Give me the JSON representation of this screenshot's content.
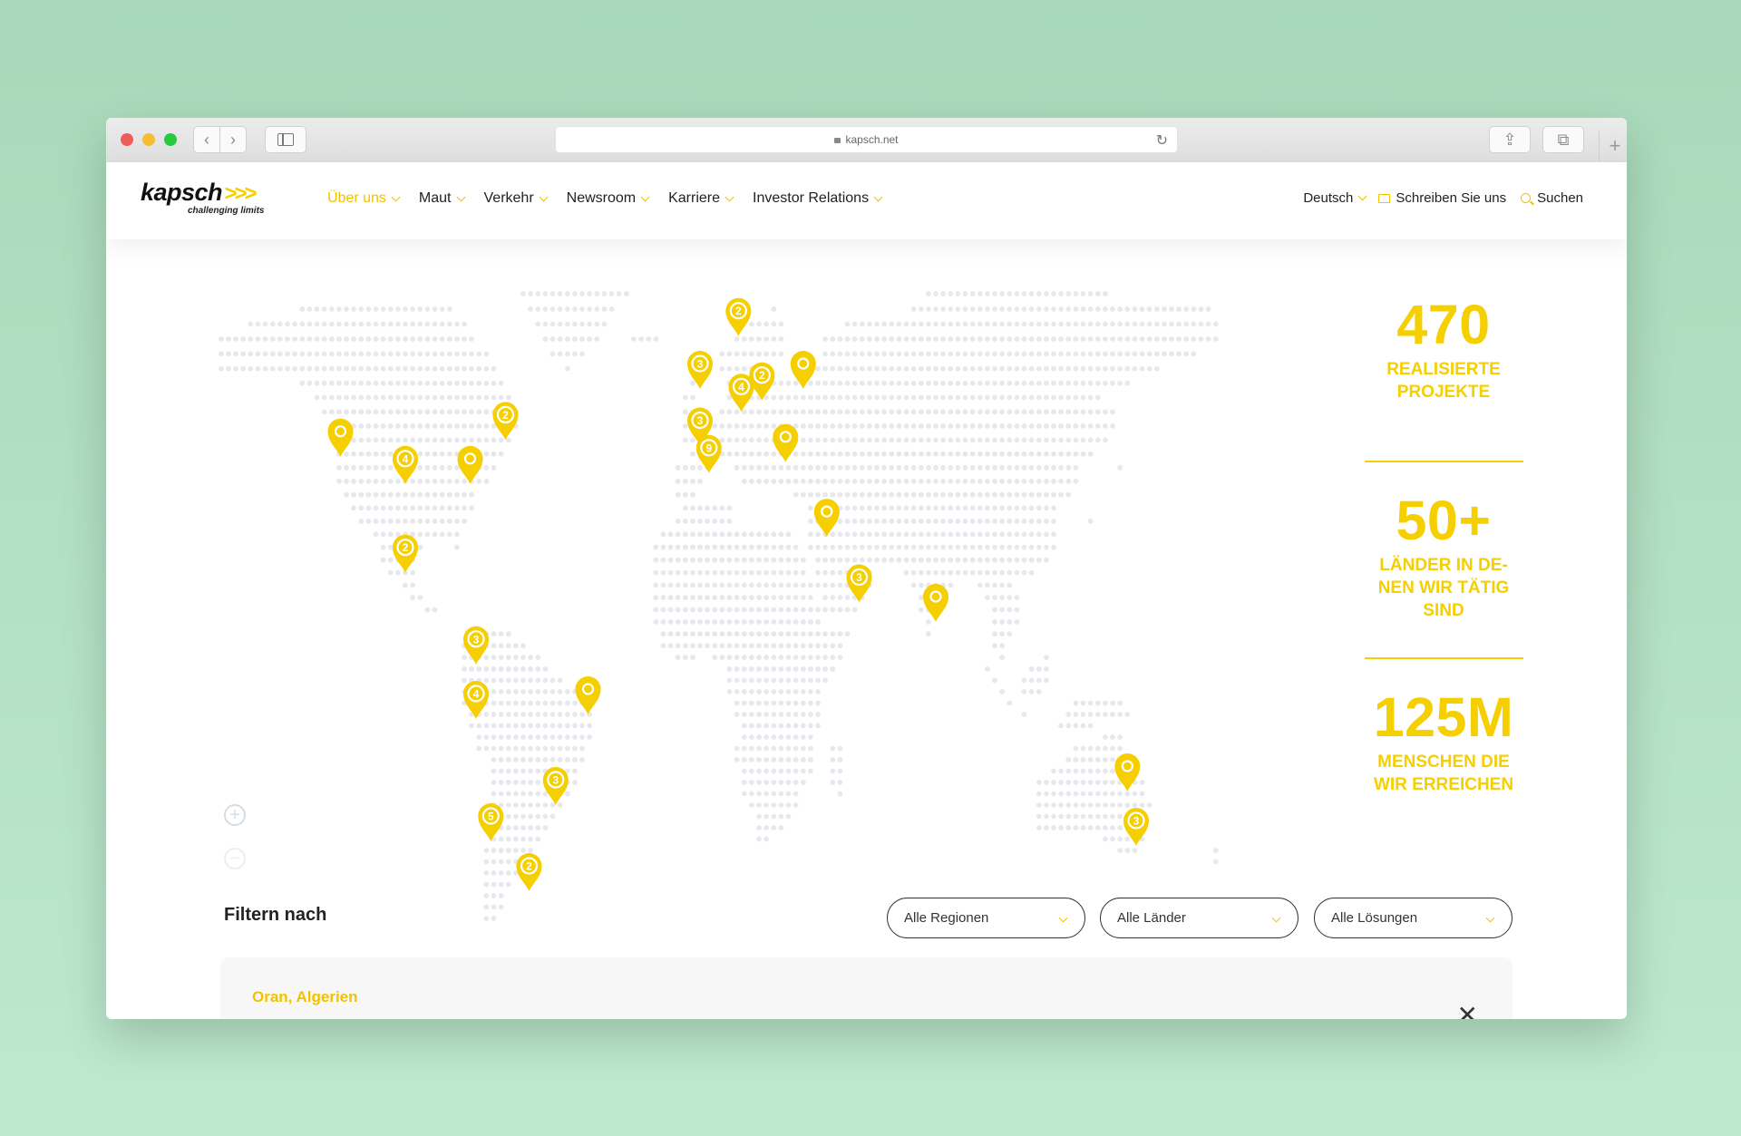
{
  "browser": {
    "url": "kapsch.net",
    "traffic_lights": [
      "#ee5e58",
      "#f5bd2f",
      "#28c840"
    ]
  },
  "brand": {
    "name": "kapsch",
    "chevrons": ">>>",
    "tagline": "challenging limits",
    "accent_color": "#f5cf00"
  },
  "nav": {
    "items": [
      {
        "label": "Über uns",
        "active": true
      },
      {
        "label": "Maut"
      },
      {
        "label": "Verkehr"
      },
      {
        "label": "Newsroom"
      },
      {
        "label": "Karriere"
      },
      {
        "label": "Investor Relations"
      }
    ],
    "language": "Deutsch",
    "contact": "Schreiben Sie uns",
    "search": "Suchen"
  },
  "map": {
    "pins": [
      {
        "label": "",
        "lon": -122,
        "lat": 45
      },
      {
        "label": "4",
        "lon": -100,
        "lat": 40
      },
      {
        "label": "2",
        "lon": -100,
        "lat": 23
      },
      {
        "label": "",
        "lon": -78,
        "lat": 40
      },
      {
        "label": "2",
        "lon": -66,
        "lat": 48
      },
      {
        "label": "3",
        "lon": -76,
        "lat": 4
      },
      {
        "label": "4",
        "lon": -76,
        "lat": -8
      },
      {
        "label": "",
        "lon": -38,
        "lat": -7
      },
      {
        "label": "3",
        "lon": -49,
        "lat": -27
      },
      {
        "label": "5",
        "lon": -71,
        "lat": -35
      },
      {
        "label": "2",
        "lon": -58,
        "lat": -46
      },
      {
        "label": "2",
        "lon": 13,
        "lat": 66
      },
      {
        "label": "3",
        "lon": 0,
        "lat": 57
      },
      {
        "label": "4",
        "lon": 14,
        "lat": 53
      },
      {
        "label": "2",
        "lon": 21,
        "lat": 55
      },
      {
        "label": "",
        "lon": 35,
        "lat": 57
      },
      {
        "label": "3",
        "lon": 0,
        "lat": 47
      },
      {
        "label": "9",
        "lon": 3,
        "lat": 42
      },
      {
        "label": "",
        "lon": 29,
        "lat": 44
      },
      {
        "label": "",
        "lon": 43,
        "lat": 30
      },
      {
        "label": "3",
        "lon": 54,
        "lat": 17
      },
      {
        "label": "",
        "lon": 80,
        "lat": 13
      },
      {
        "label": "",
        "lon": 145,
        "lat": -24
      },
      {
        "label": "3",
        "lon": 148,
        "lat": -36
      }
    ],
    "zoom_in": "+",
    "zoom_out": "−"
  },
  "stats": [
    {
      "value": "470",
      "label_lines": [
        "REALISIERTE",
        "PROJEKTE"
      ]
    },
    {
      "value": "50+",
      "label_lines": [
        "LÄNDER IN DE-",
        "NEN WIR TÄTIG",
        "SIND"
      ]
    },
    {
      "value": "125M",
      "label_lines": [
        "MENSCHEN DIE",
        "WIR ERREICHEN"
      ]
    }
  ],
  "filter": {
    "title": "Filtern nach",
    "regions": "Alle Regionen",
    "countries": "Alle Länder",
    "solutions": "Alle Lösungen"
  },
  "result": {
    "title": "Oran, Algerien",
    "close": "✕"
  }
}
